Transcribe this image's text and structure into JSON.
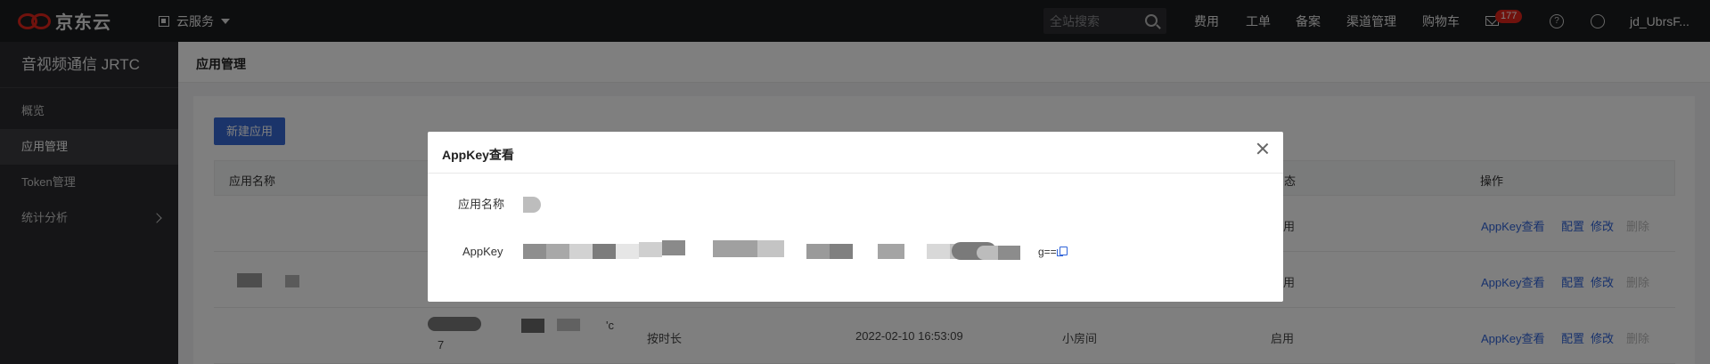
{
  "topbar": {
    "brand": "京东云",
    "service_menu": "云服务",
    "search_placeholder": "全站搜索",
    "nav": [
      "费用",
      "工单",
      "备案",
      "渠道管理",
      "购物车"
    ],
    "mail_badge": "177",
    "help_glyph": "?",
    "user": "jd_UbrsF..."
  },
  "sidebar": {
    "title": "音视频通信 JRTC",
    "items": [
      {
        "label": "概览"
      },
      {
        "label": "应用管理",
        "active": true
      },
      {
        "label": "Token管理"
      },
      {
        "label": "统计分析"
      }
    ]
  },
  "page": {
    "title": "应用管理",
    "new_button": "新建应用"
  },
  "table": {
    "headers": [
      "应用名称",
      "态",
      "操作"
    ],
    "rows": [
      {
        "status": "用",
        "ops": [
          "AppKey查看",
          "配置",
          "修改",
          "删除"
        ]
      },
      {
        "status": "用",
        "ops": [
          "AppKey查看",
          "配置",
          "修改",
          "删除"
        ]
      },
      {
        "name_tail": "7",
        "name_suffix": "'c",
        "billing": "按时长",
        "created": "2022-02-10 16:53:09",
        "room_type": "小房间",
        "status": "启用",
        "ops": [
          "AppKey查看",
          "配置",
          "修改",
          "删除"
        ]
      }
    ]
  },
  "modal": {
    "title": "AppKey查看",
    "fields": [
      {
        "label": "应用名称"
      },
      {
        "label": "AppKey",
        "value_tail": "g=="
      }
    ]
  },
  "colors": {
    "topbar_bg": "#1b1c1e",
    "sidebar_bg": "#2a2b2e",
    "accent": "#3768d4",
    "link": "#2f63d8",
    "brand_red": "#e1251b"
  }
}
